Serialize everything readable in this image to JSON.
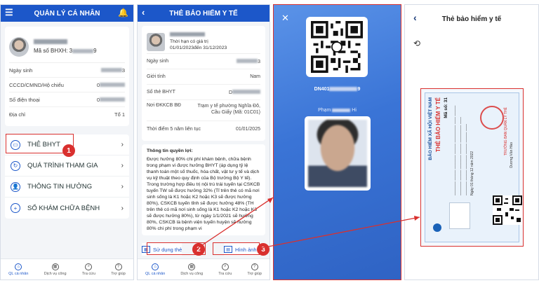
{
  "panel1": {
    "title": "QUẢN LÝ CÁ NHÂN",
    "bhxh_label": "Mã số BHXH: 3",
    "bhxh_tail": "9",
    "rows": [
      {
        "label": "Ngày sinh",
        "value": "3"
      },
      {
        "label": "CCCD/CMND/Hộ chiếu",
        "value": "0"
      },
      {
        "label": "Số điện thoại",
        "value": "0"
      },
      {
        "label": "Địa chỉ",
        "value": "Tổ 1"
      }
    ],
    "menu": [
      {
        "label": "THẺ BHYT",
        "icon": "card-icon"
      },
      {
        "label": "QUÁ TRÌNH THAM GIA",
        "icon": "history-icon"
      },
      {
        "label": "THÔNG TIN HƯỞNG",
        "icon": "user-info-icon"
      },
      {
        "label": "SỔ KHÁM CHỮA BỆNH",
        "icon": "medical-cross-icon"
      }
    ],
    "badge": "1"
  },
  "bottom_tabs": [
    "QL cá nhân",
    "Dịch vụ công",
    "Tra cứu",
    "Trợ giúp"
  ],
  "panel2": {
    "title": "THẺ BẢO HIỂM Y TẾ",
    "validity_label": "Thời hạn có giá trị",
    "validity_value": "01/01/2023đến  31/12/2023",
    "rows": [
      {
        "label": "Ngày sinh",
        "value": "3"
      },
      {
        "label": "Giới tính",
        "value": "Nam"
      },
      {
        "label": "Số thẻ BHYT",
        "value": "D"
      },
      {
        "label": "Nơi ĐKKCB BĐ",
        "value": "Trạm y tế phường Nghĩa Đô, Cầu Giấy (Mã: 01C01)"
      },
      {
        "label": "Thời điểm 5 năm liên tục",
        "value": "01/01/2025"
      }
    ],
    "benefit_title": "Thông tin quyền lợi:",
    "benefit_text": "Được hưởng 80% chi phí khám bệnh, chữa bệnh trong phạm vi được hưởng BHYT (áp dụng tỷ lệ thanh toán một số thuốc, hóa chất, vật tư y tế và dịch vụ kỹ thuật theo quy định của Bộ trưởng Bộ Y tế). Trong trường hợp điều trị nội trú trái tuyến tại CSKCB tuyến TW sẽ được hưởng 32% (Tỉ trên thẻ có mã nơi sinh sống là K1 hoặc K2 hoặc K3 sẽ được hưởng 80%), CSKCB tuyến tỉnh sẽ được hưởng 48% (TH trên thẻ có mã nơi sinh sống là K1 hoặc K2 hoặc K3 sẽ được hưởng 80%), từ ngày 1/1/2021 sẽ hưởng 80%, CSKCB là bệnh viện tuyến huyện sẽ hưởng 80% chi phí trong phạm vi",
    "action_use": "Sử dụng thẻ",
    "action_image": "Hình ảnh thẻ",
    "badge2": "2",
    "badge3": "3"
  },
  "panel3": {
    "card_no_prefix": "DN401",
    "card_no_suffix": "9",
    "holder_prefix": "Phạm",
    "holder_suffix": "Hi"
  },
  "panel4": {
    "title": "Thẻ bảo hiểm y tế",
    "org": "BẢO HIỂM XÃ HỘI VIỆT NAM",
    "card_title": "THẺ BẢO HIỂM Y TẾ",
    "code": "Mã số: 31",
    "stamp_text": "TRƯỞNG BAN QUẢN LÝ THẺ",
    "sign_name": "Dương Văn Hào",
    "issue_line": "Ngày 01 tháng 12 năm 2022"
  },
  "colors": {
    "brand": "#1c57c9",
    "highlight": "#d9302e"
  }
}
